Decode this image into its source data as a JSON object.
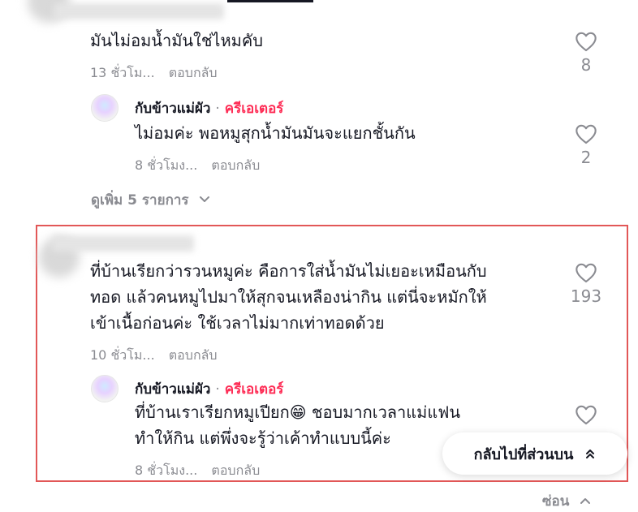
{
  "comments": [
    {
      "text": "มันไม่อมน้ำมันใช่ไหมคับ",
      "time": "13 ชั่วโม...",
      "reply_label": "ตอบกลับ",
      "likes": "8",
      "replies": [
        {
          "author": "กับข้าวแม่ผัว",
          "separator": "·",
          "badge": "ครีเอเตอร์",
          "text": "ไม่อมค่ะ พอหมูสุกน้ำมันมันจะแยกชั้นกัน",
          "time": "8 ชั่วโมง...",
          "reply_label": "ตอบกลับ",
          "likes": "2"
        }
      ],
      "view_more": "ดูเพิ่ม 5 รายการ"
    },
    {
      "text_lines": [
        "ที่บ้านเรียกว่ารวนหมูค่ะ คือการใส่น้ำมันไม่เยอะเหมือนกับ",
        "ทอด แล้วคนหมูไปมาให้สุกจนเหลืองน่ากิน แต่นี่จะหมักให้",
        "เข้าเนื้อก่อนค่ะ ใช้เวลาไม่มากเท่าทอดด้วย"
      ],
      "time": "10 ชั่วโม...",
      "reply_label": "ตอบกลับ",
      "likes": "193",
      "replies": [
        {
          "author": "กับข้าวแม่ผัว",
          "separator": "·",
          "badge": "ครีเอเตอร์",
          "text_lines": [
            "ที่บ้านเราเรียกหมูเปียก😁 ชอบมากเวลาแม่แฟน",
            "ทำให้กิน แต่พึ่งจะรู้ว่าเค้าทำแบบนี้ค่ะ"
          ],
          "time": "8 ชั่วโมง...",
          "reply_label": "ตอบกลับ"
        }
      ]
    }
  ],
  "back_to_top": "กลับไปที่ส่วนบน",
  "hide_label": "ซ่อน",
  "icons": {
    "like": "heart-outline-icon",
    "expand": "chevron-down-icon",
    "collapse": "chevron-up-icon",
    "back_to_top": "double-chevron-up-icon"
  },
  "colors": {
    "creator_badge": "#fe2c55",
    "meta_text": "#8a8b91",
    "highlight_border": "#e25757"
  }
}
